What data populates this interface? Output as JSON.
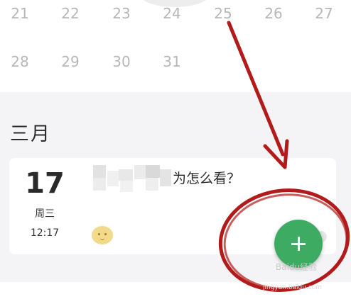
{
  "calendar": {
    "rows": [
      [
        "21",
        "22",
        "23",
        "24",
        "25",
        "26",
        "27"
      ],
      [
        "28",
        "29",
        "30",
        "31"
      ]
    ]
  },
  "month_title": "三月",
  "entry": {
    "day": "17",
    "weekday": "周三",
    "time": "12:17",
    "text": "为怎么看？",
    "emoji_icon": "smiley-emoji-icon"
  },
  "fab": {
    "icon": "plus-icon",
    "color": "#3dab62"
  },
  "annotation": {
    "color": "#b31a1a"
  },
  "watermark": {
    "text": "Baidu经验",
    "url": "jingyan.baidu.com"
  }
}
